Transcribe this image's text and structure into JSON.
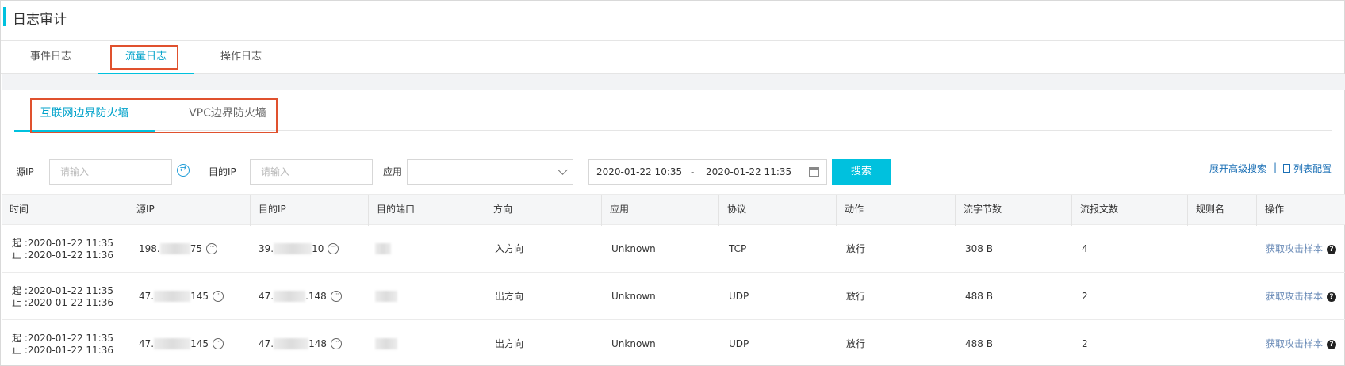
{
  "header": {
    "title": "日志审计"
  },
  "top_tabs": [
    {
      "label": "事件日志"
    },
    {
      "label": "流量日志",
      "active": true
    },
    {
      "label": "操作日志"
    }
  ],
  "sub_tabs": [
    {
      "label": "互联网边界防火墙",
      "active": true
    },
    {
      "label": "VPC边界防火墙"
    }
  ],
  "filters": {
    "src_ip_label": "源IP",
    "src_ip_placeholder": "请输入",
    "dst_ip_label": "目的IP",
    "dst_ip_placeholder": "请输入",
    "app_label": "应用",
    "app_value": "",
    "start_time": "2020-01-22 10:35",
    "range_separator": "-",
    "end_time": "2020-01-22 11:35",
    "search_label": "搜索",
    "advanced_search": "展开高级搜索",
    "separator": "|",
    "column_config": "列表配置"
  },
  "table": {
    "columns": [
      "时间",
      "源IP",
      "目的IP",
      "目的端口",
      "方向",
      "应用",
      "协议",
      "动作",
      "流字节数",
      "流报文数",
      "规则名",
      "操作"
    ],
    "rows": [
      {
        "start": "起 :2020-01-22 11:35",
        "end": "止 :2020-01-22 11:36",
        "src_prefix": "198.",
        "src_suffix": "75",
        "dst_prefix": "39.",
        "dst_suffix": "10",
        "direction": "入方向",
        "app": "Unknown",
        "protocol": "TCP",
        "action": "放行",
        "bytes": "308 B",
        "packets": "4",
        "rule": "",
        "op": "获取攻击样本"
      },
      {
        "start": "起 :2020-01-22 11:35",
        "end": "止 :2020-01-22 11:36",
        "src_prefix": "47.",
        "src_suffix": "145",
        "dst_prefix": "47.",
        "dst_suffix": ".148",
        "direction": "出方向",
        "app": "Unknown",
        "protocol": "UDP",
        "action": "放行",
        "bytes": "488 B",
        "packets": "2",
        "rule": "",
        "op": "获取攻击样本"
      },
      {
        "start": "起 :2020-01-22 11:35",
        "end": "止 :2020-01-22 11:36",
        "src_prefix": "47.",
        "src_suffix": "145",
        "dst_prefix": "47.",
        "dst_suffix": "148",
        "direction": "出方向",
        "app": "Unknown",
        "protocol": "UDP",
        "action": "放行",
        "bytes": "488 B",
        "packets": "2",
        "rule": "",
        "op": "获取攻击样本"
      }
    ],
    "more_icon": "ellipsis-circle-icon",
    "help_icon": "question-circle-icon"
  },
  "colors": {
    "accent": "#00c1de",
    "highlight_box": "#e0512e",
    "link": "#1a6fb5"
  }
}
